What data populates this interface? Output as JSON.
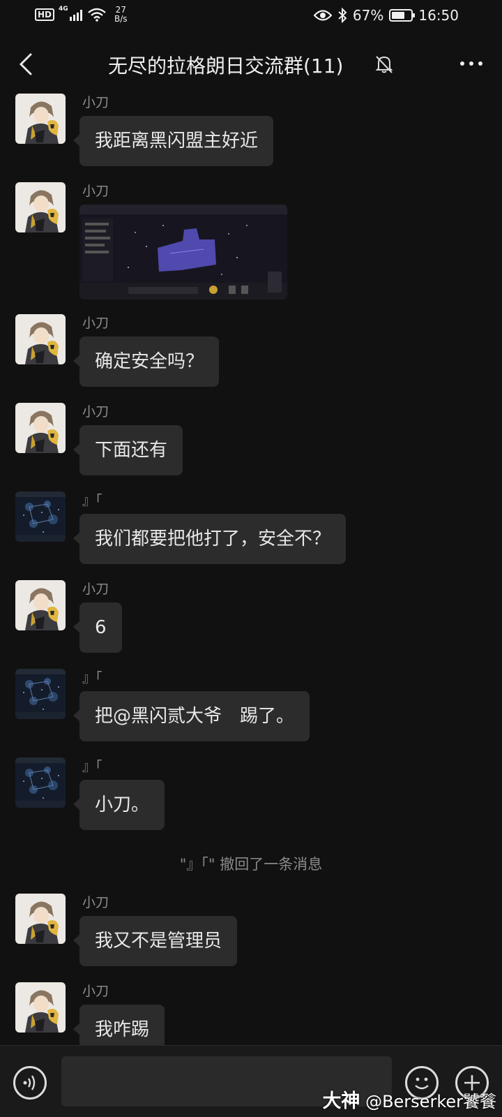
{
  "status_bar": {
    "hd": "HD",
    "network": "4G",
    "speed_value": "27",
    "speed_unit": "B/s",
    "battery": "67%",
    "battery_level": 0.67,
    "time": "16:50"
  },
  "header": {
    "title": "无尽的拉格朗日交流群(11)"
  },
  "messages": [
    {
      "sender": "小刀",
      "text": "我距离黑闪盟主好近"
    },
    {
      "sender": "小刀",
      "image": "game-screenshot"
    },
    {
      "sender": "小刀",
      "text": "确定安全吗？"
    },
    {
      "sender": "小刀",
      "text": "下面还有"
    },
    {
      "sender": "』「",
      "text": "我们都要把他打了，安全不？"
    },
    {
      "sender": "小刀",
      "text": "6"
    },
    {
      "sender": "』「",
      "text": "把@黑闪贰大爷　踢了。"
    },
    {
      "sender": "』「",
      "text": "小刀。"
    },
    {
      "system": "\"』「\" 撤回了一条消息"
    },
    {
      "sender": "小刀",
      "text": "我又不是管理员"
    },
    {
      "sender": "小刀",
      "text": "我咋踢"
    }
  ],
  "watermark": {
    "brand": "大神",
    "handle": "@Berserker饕餮"
  },
  "colors": {
    "background": "#111111",
    "bubble": "#2c2c2c",
    "sender_text": "#8e8e8e",
    "input_bar": "#1a1a1a"
  },
  "icons": {
    "back": "chevron-left-icon",
    "mute": "bell-muted-icon",
    "more": "more-dots-icon",
    "voice": "voice-icon",
    "emoji": "emoji-icon",
    "plus": "plus-icon"
  }
}
